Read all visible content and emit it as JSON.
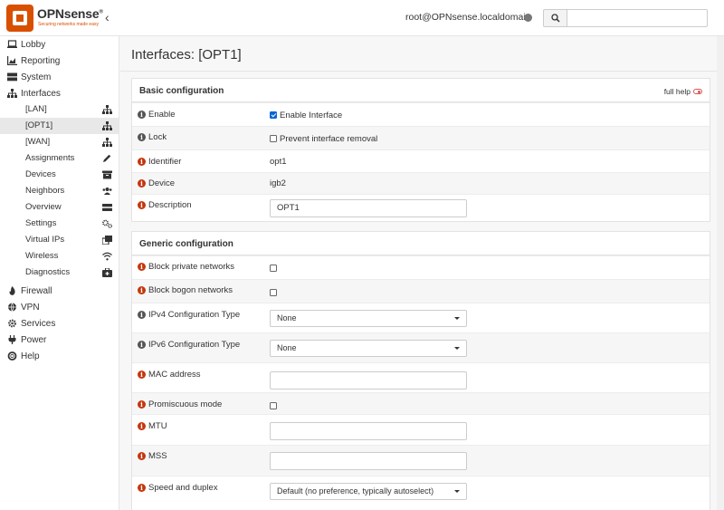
{
  "brand": {
    "name": "OPNsense",
    "mark": "®",
    "tagline": "Securing networks made easy"
  },
  "header": {
    "user": "root@OPNsense.localdomain",
    "search_placeholder": ""
  },
  "sidebar": {
    "top": [
      {
        "label": "Lobby",
        "icon": "laptop-icon"
      },
      {
        "label": "Reporting",
        "icon": "area-chart-icon"
      },
      {
        "label": "System",
        "icon": "server-icon"
      },
      {
        "label": "Interfaces",
        "icon": "sitemap-icon"
      }
    ],
    "interfaces_sub": [
      {
        "label": "[LAN]",
        "icon": "sitemap-icon"
      },
      {
        "label": "[OPT1]",
        "icon": "sitemap-icon"
      },
      {
        "label": "[WAN]",
        "icon": "sitemap-icon"
      },
      {
        "label": "Assignments",
        "icon": "pencil-icon"
      },
      {
        "label": "Devices",
        "icon": "archive-icon"
      },
      {
        "label": "Neighbors",
        "icon": "users-icon"
      },
      {
        "label": "Overview",
        "icon": "tasks-icon"
      },
      {
        "label": "Settings",
        "icon": "cogs-icon"
      },
      {
        "label": "Virtual IPs",
        "icon": "clone-icon"
      },
      {
        "label": "Wireless",
        "icon": "wifi-icon"
      },
      {
        "label": "Diagnostics",
        "icon": "medkit-icon"
      }
    ],
    "bottom": [
      {
        "label": "Firewall",
        "icon": "fire-icon"
      },
      {
        "label": "VPN",
        "icon": "globe-icon"
      },
      {
        "label": "Services",
        "icon": "cog-icon"
      },
      {
        "label": "Power",
        "icon": "plug-icon"
      },
      {
        "label": "Help",
        "icon": "life-ring-icon"
      }
    ]
  },
  "page": {
    "title": "Interfaces: [OPT1]"
  },
  "basic": {
    "heading": "Basic configuration",
    "full_help": "full help",
    "enable_label": "Enable",
    "enable_cb_label": "Enable Interface",
    "lock_label": "Lock",
    "lock_cb_label": "Prevent interface removal",
    "identifier_label": "Identifier",
    "identifier_value": "opt1",
    "device_label": "Device",
    "device_value": "igb2",
    "description_label": "Description",
    "description_value": "OPT1"
  },
  "generic": {
    "heading": "Generic configuration",
    "block_private_label": "Block private networks",
    "block_bogon_label": "Block bogon networks",
    "ipv4_label": "IPv4 Configuration Type",
    "ipv4_value": "None",
    "ipv6_label": "IPv6 Configuration Type",
    "ipv6_value": "None",
    "mac_label": "MAC address",
    "mac_value": "",
    "promisc_label": "Promiscuous mode",
    "mtu_label": "MTU",
    "mtu_value": "",
    "mss_label": "MSS",
    "mss_value": "",
    "speed_label": "Speed and duplex",
    "speed_value": "Default (no preference, typically autoselect)"
  },
  "colors": {
    "accent": "#d94f00",
    "info_orange": "#c4370d",
    "checkbox_blue": "#0a66d6"
  }
}
